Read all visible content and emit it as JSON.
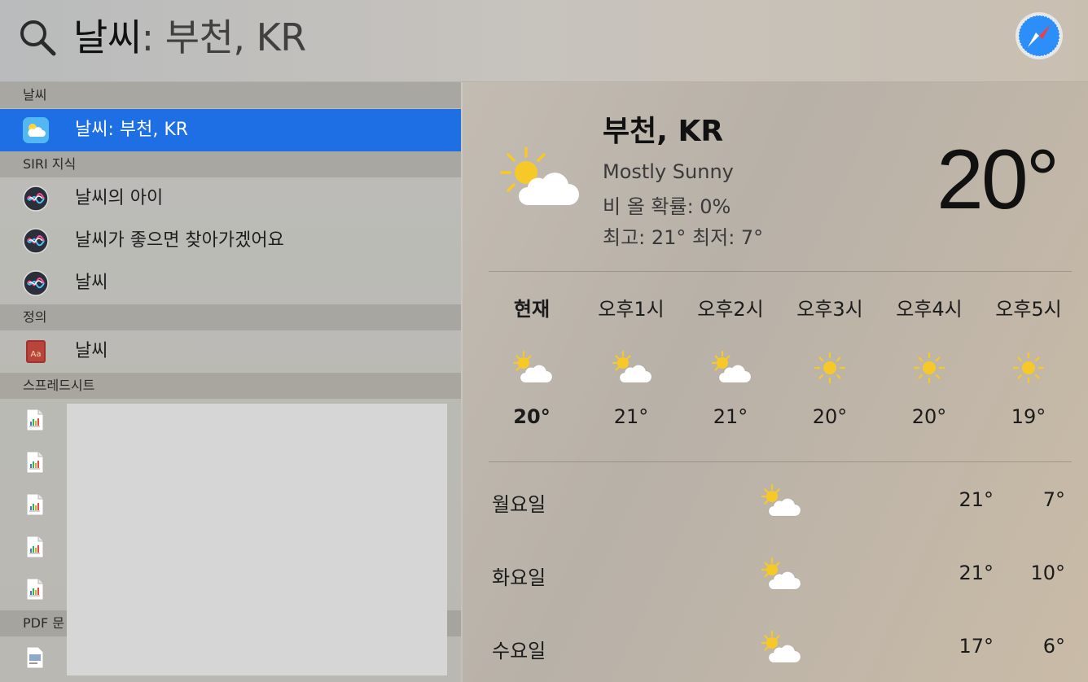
{
  "search": {
    "typed": "날씨",
    "completion": ": 부천, KR"
  },
  "results": {
    "sections": {
      "weather": "날씨",
      "siri": "SIRI 지식",
      "definition": "정의",
      "spreadsheets": "스프레드시트",
      "pdf": "PDF 문"
    },
    "weather_item": "날씨: 부천, KR",
    "siri_items": [
      "날씨의 아이",
      "날씨가 좋으면 찾아가겠어요",
      "날씨"
    ],
    "definition_item": "날씨"
  },
  "weather": {
    "city": "부천, KR",
    "condition": "Mostly Sunny",
    "rain_chance": "비 올 확률: 0%",
    "hi_lo": "최고: 21° 최저: 7°",
    "current_temp": "20°",
    "hourly": [
      {
        "label": "현재",
        "icon": "partly-sunny-icon",
        "temp": "20°"
      },
      {
        "label": "오후1시",
        "icon": "partly-sunny-icon",
        "temp": "21°"
      },
      {
        "label": "오후2시",
        "icon": "partly-sunny-icon",
        "temp": "21°"
      },
      {
        "label": "오후3시",
        "icon": "sun-icon",
        "temp": "20°"
      },
      {
        "label": "오후4시",
        "icon": "sun-icon",
        "temp": "20°"
      },
      {
        "label": "오후5시",
        "icon": "sun-icon",
        "temp": "19°"
      }
    ],
    "daily": [
      {
        "day": "월요일",
        "icon": "partly-sunny-icon",
        "hi": "21°",
        "lo": "7°"
      },
      {
        "day": "화요일",
        "icon": "partly-sunny-icon",
        "hi": "21°",
        "lo": "10°"
      },
      {
        "day": "수요일",
        "icon": "partly-sunny-icon",
        "hi": "17°",
        "lo": "6°"
      }
    ]
  },
  "colors": {
    "selection": "#1e6fe3",
    "sun": "#f6c928",
    "cloud": "#ffffff"
  }
}
